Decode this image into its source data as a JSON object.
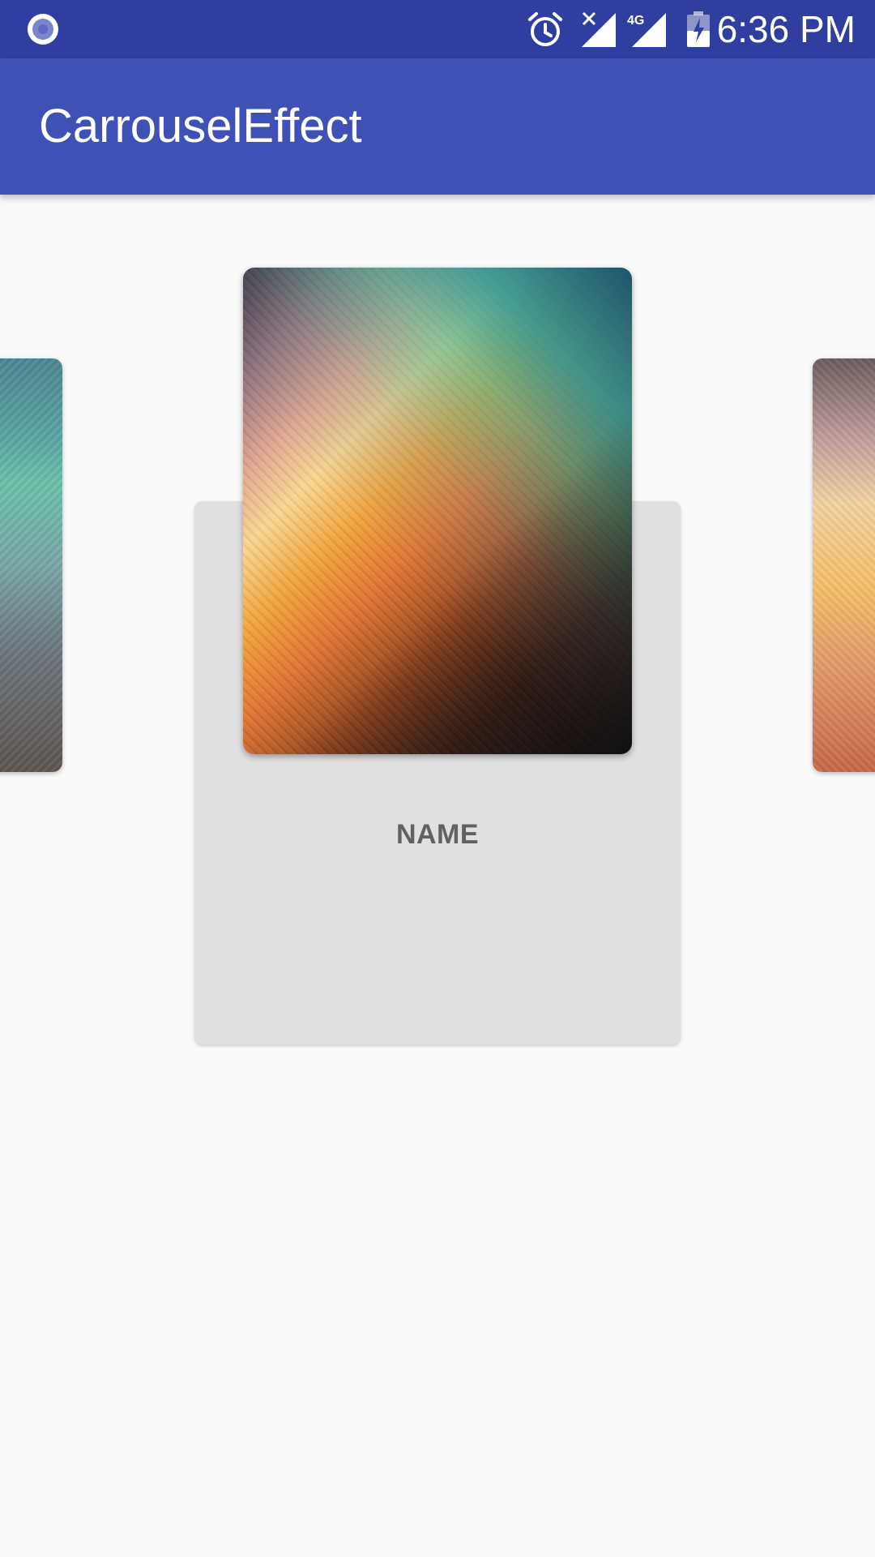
{
  "status_bar": {
    "time": "6:36 PM",
    "icons": [
      "record-icon",
      "alarm-icon",
      "signal-no-sim-icon",
      "signal-4g-icon",
      "battery-charging-icon"
    ],
    "network_label": "4G",
    "background_color": "#303f9f"
  },
  "app_bar": {
    "title": "CarrouselEffect",
    "background_color": "#3f51b5"
  },
  "carousel": {
    "current_item": {
      "name": "NAME"
    },
    "items_visible": 3
  }
}
